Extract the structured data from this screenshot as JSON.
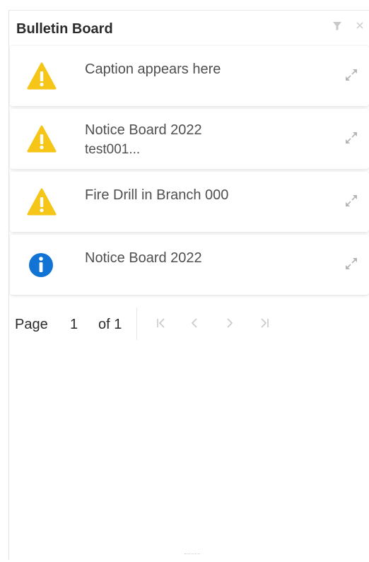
{
  "header": {
    "title": "Bulletin Board",
    "filter_icon": "filter-icon",
    "close_icon": "close-icon"
  },
  "items": [
    {
      "icon": "warning-icon",
      "caption": "Caption appears here",
      "subtext": ""
    },
    {
      "icon": "warning-icon",
      "caption": "Notice Board 2022",
      "subtext": "test001..."
    },
    {
      "icon": "warning-icon",
      "caption": "Fire Drill in Branch 000",
      "subtext": ""
    },
    {
      "icon": "info-icon",
      "caption": "Notice Board 2022",
      "subtext": ""
    }
  ],
  "pager": {
    "page_label": "Page",
    "current_page": "1",
    "of_label": "of 1"
  },
  "colors": {
    "warning": "#f5c518",
    "info": "#1173d4",
    "disabled": "#c9c9c9"
  }
}
